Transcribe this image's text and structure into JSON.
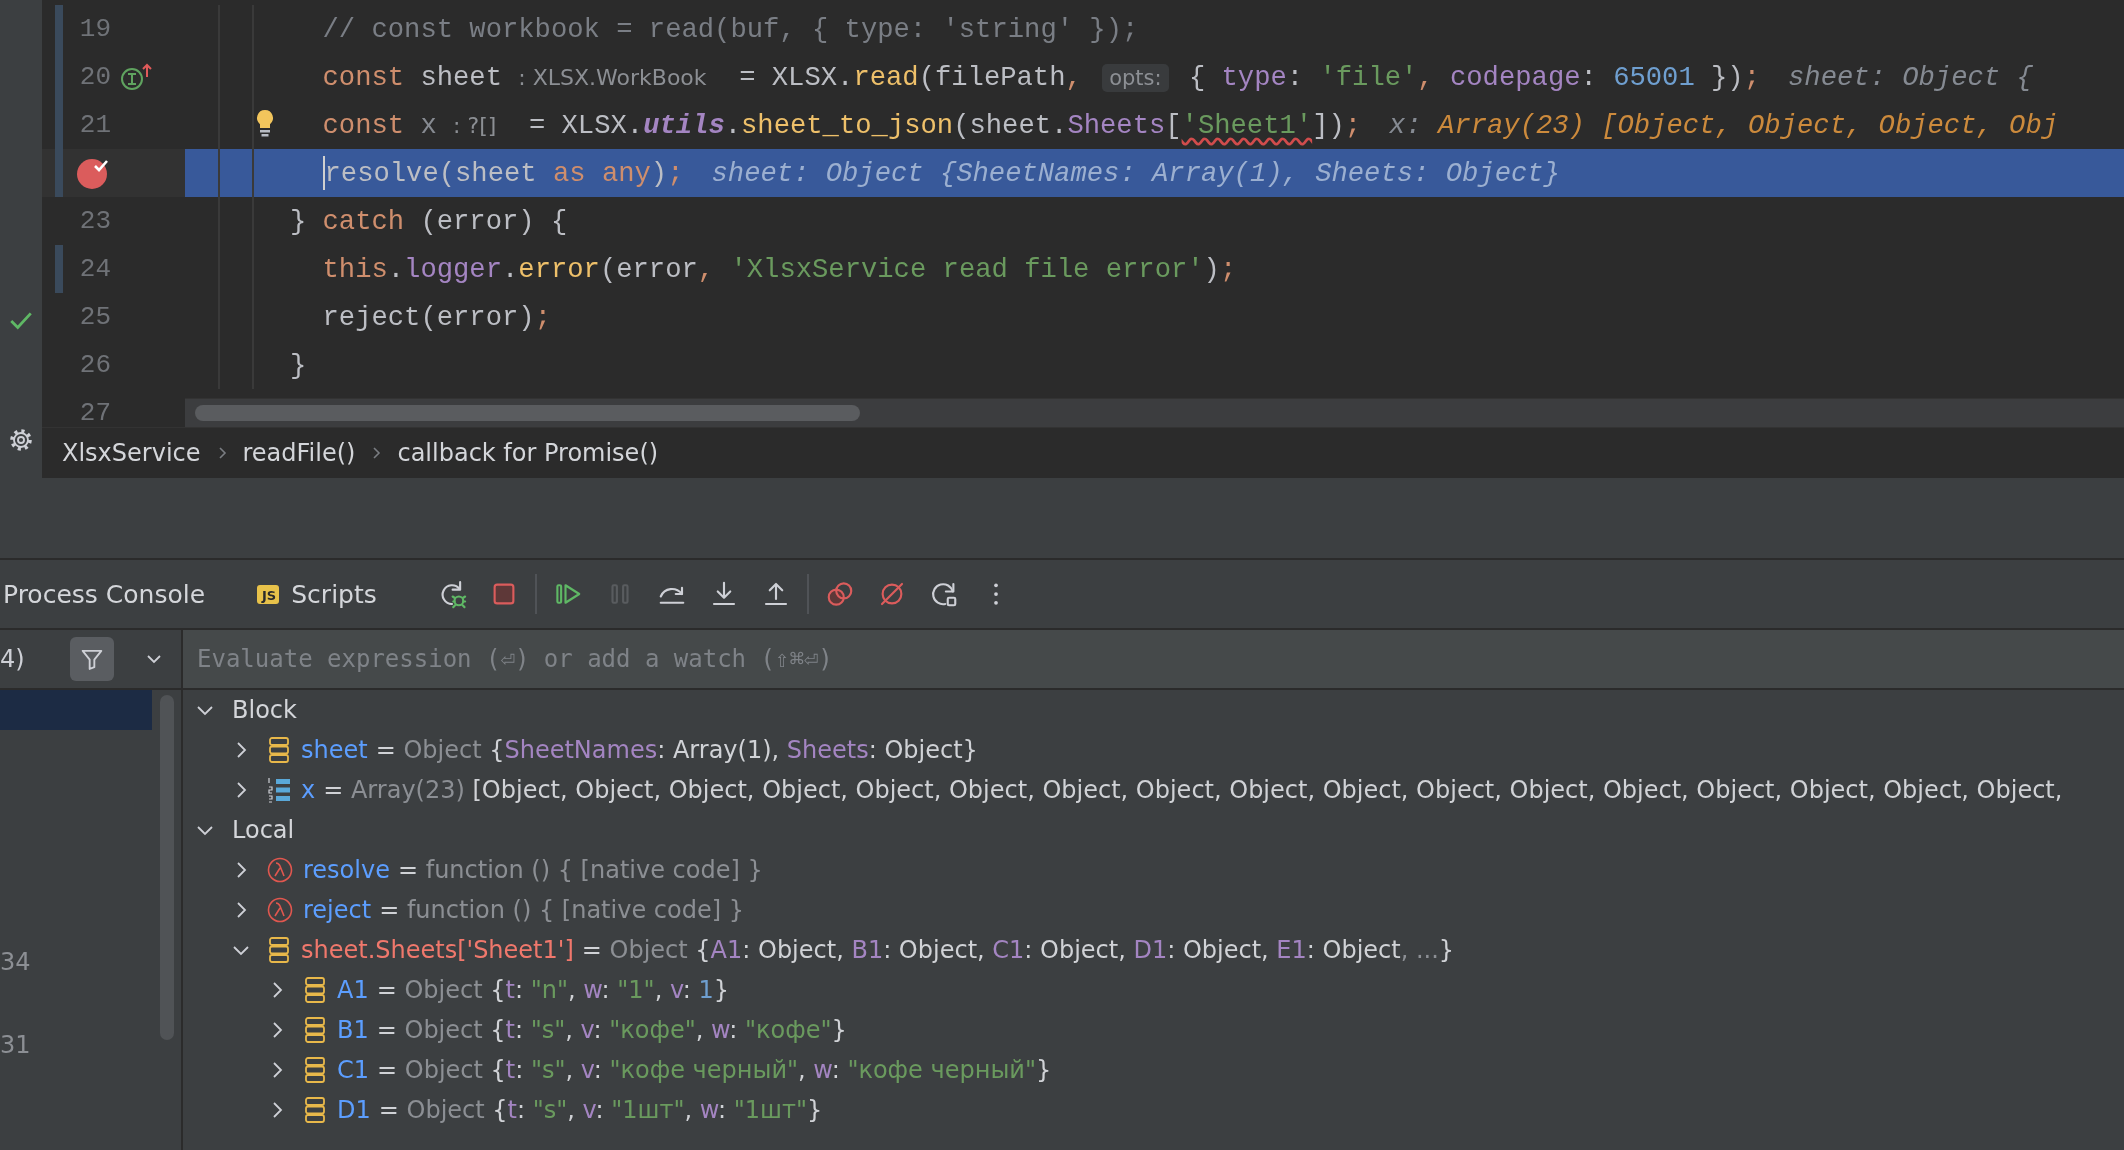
{
  "left_strip": {
    "icons": [
      {
        "kind": "check"
      },
      {
        "kind": "settings"
      }
    ]
  },
  "editor": {
    "lines": [
      {
        "number": "19",
        "changed": true,
        "current": false,
        "breakpoint": false,
        "bulb": false,
        "gutter_marker": false,
        "outer": false,
        "tokens": [
          {
            "kind": "comment",
            "text": "// const workbook = read(buf, { type: 'string' });"
          }
        ]
      },
      {
        "number": "20",
        "changed": true,
        "current": false,
        "breakpoint": false,
        "bulb": false,
        "gutter_marker": true,
        "outer": false,
        "tokens": [
          {
            "kind": "kw",
            "text": "const"
          },
          {
            "kind": "plain",
            "text": " sheet "
          },
          {
            "kind": "hint",
            "text": ": XLSX.WorkBook"
          },
          {
            "kind": "plain",
            "text": "  = XLSX."
          },
          {
            "kind": "method",
            "text": "read"
          },
          {
            "kind": "plain",
            "text": "(filePath"
          },
          {
            "kind": "kw",
            "text": ", "
          },
          {
            "kind": "hintbox",
            "text": "opts:"
          },
          {
            "kind": "plain",
            "text": " { "
          },
          {
            "kind": "prop",
            "text": "type"
          },
          {
            "kind": "plain",
            "text": ": "
          },
          {
            "kind": "str",
            "text": "'file'"
          },
          {
            "kind": "kw",
            "text": ", "
          },
          {
            "kind": "prop",
            "text": "codepage"
          },
          {
            "kind": "plain",
            "text": ": "
          },
          {
            "kind": "num",
            "text": "65001"
          },
          {
            "kind": "plain",
            "text": " })"
          },
          {
            "kind": "kw",
            "text": ";"
          }
        ],
        "inline_value": [
          {
            "kind": "dbg",
            "text": "sheet: Object {"
          }
        ]
      },
      {
        "number": "21",
        "changed": true,
        "current": false,
        "breakpoint": false,
        "bulb": true,
        "gutter_marker": false,
        "outer": false,
        "tokens": [
          {
            "kind": "kw",
            "text": "const"
          },
          {
            "kind": "unused",
            "text": " x "
          },
          {
            "kind": "hint",
            "text": ": ?[]"
          },
          {
            "kind": "plain",
            "text": "  = XLSX."
          },
          {
            "kind": "propital",
            "text": "utils"
          },
          {
            "kind": "plain",
            "text": "."
          },
          {
            "kind": "method",
            "text": "sheet_to_json"
          },
          {
            "kind": "plain",
            "text": "(sheet."
          },
          {
            "kind": "prop",
            "text": "Sheets"
          },
          {
            "kind": "plain",
            "text": "["
          },
          {
            "kind": "strwarn",
            "text": "'Sheet1'"
          },
          {
            "kind": "plain",
            "text": "])"
          },
          {
            "kind": "kw",
            "text": ";"
          }
        ],
        "inline_value": [
          {
            "kind": "dbg",
            "text": "x: "
          },
          {
            "kind": "dbgval",
            "text": "Array(23) [Object, Object, Object, Obj"
          }
        ]
      },
      {
        "changed": true,
        "current": true,
        "breakpoint": true,
        "bulb": false,
        "gutter_marker": false,
        "outer": false,
        "tokens": [
          {
            "kind": "plain",
            "text": "resolve(sheet "
          },
          {
            "kind": "kw",
            "text": "as any"
          },
          {
            "kind": "plain",
            "text": ")"
          },
          {
            "kind": "kw",
            "text": ";"
          }
        ],
        "inline_value": [
          {
            "kind": "dbg",
            "text": "sheet: Object {SheetNames: Array(1), Sheets: Object}"
          }
        ]
      },
      {
        "number": "23",
        "changed": false,
        "current": false,
        "breakpoint": false,
        "bulb": false,
        "gutter_marker": false,
        "outer": true,
        "tokens": [
          {
            "kind": "plain",
            "text": "} "
          },
          {
            "kind": "kw",
            "text": "catch"
          },
          {
            "kind": "plain",
            "text": " (error) {"
          }
        ]
      },
      {
        "number": "24",
        "changed": true,
        "current": false,
        "breakpoint": false,
        "bulb": false,
        "gutter_marker": false,
        "outer": false,
        "tokens": [
          {
            "kind": "kw",
            "text": "this"
          },
          {
            "kind": "plain",
            "text": "."
          },
          {
            "kind": "prop",
            "text": "logger"
          },
          {
            "kind": "plain",
            "text": "."
          },
          {
            "kind": "method",
            "text": "error"
          },
          {
            "kind": "plain",
            "text": "(error"
          },
          {
            "kind": "kw",
            "text": ", "
          },
          {
            "kind": "str",
            "text": "'XlsxService read file error'"
          },
          {
            "kind": "plain",
            "text": ")"
          },
          {
            "kind": "kw",
            "text": ";"
          }
        ]
      },
      {
        "number": "25",
        "changed": false,
        "current": false,
        "breakpoint": false,
        "bulb": false,
        "gutter_marker": false,
        "outer": false,
        "tokens": [
          {
            "kind": "plain",
            "text": "reject(error)"
          },
          {
            "kind": "kw",
            "text": ";"
          }
        ]
      },
      {
        "number": "26",
        "changed": false,
        "current": false,
        "breakpoint": false,
        "bulb": false,
        "gutter_marker": false,
        "outer": true,
        "tokens": [
          {
            "kind": "plain",
            "text": "}"
          }
        ]
      },
      {
        "number": "27",
        "changed": false,
        "current": false,
        "breakpoint": false,
        "bulb": false,
        "gutter_marker": false
      }
    ]
  },
  "breadcrumbs": [
    "XlsxService",
    "readFile()",
    "callback for Promise()"
  ],
  "debugger": {
    "tabs": [
      {
        "label": "Process Console"
      },
      {
        "label": "Scripts",
        "badge": "JS"
      }
    ],
    "toolbar": [
      {
        "kind": "rerun",
        "disabled": false
      },
      {
        "kind": "stop",
        "disabled": false
      },
      {
        "kind": "separator"
      },
      {
        "kind": "resume",
        "disabled": false
      },
      {
        "kind": "pause",
        "disabled": true
      },
      {
        "kind": "step-over",
        "disabled": false
      },
      {
        "kind": "step-into",
        "disabled": false
      },
      {
        "kind": "step-out",
        "disabled": false
      },
      {
        "kind": "separator"
      },
      {
        "kind": "breakpoints",
        "disabled": false
      },
      {
        "kind": "mute",
        "disabled": false
      },
      {
        "kind": "restart",
        "disabled": false
      },
      {
        "kind": "more",
        "disabled": false
      }
    ],
    "frames": {
      "count_text": "4)",
      "filter_on": true,
      "selected_row": {
        "selected": true
      },
      "rows": [
        {
          "text": "34",
          "selected": false
        },
        {
          "text": "31",
          "selected": false
        }
      ]
    },
    "watch_field": {
      "placeholder": "Evaluate expression (⏎) or add a watch (⇧⌘⏎)"
    },
    "variables": [
      {
        "name": "Block",
        "kind": "group",
        "expanded": true,
        "children": [
          {
            "name": "sheet",
            "kind": "object",
            "expanded": false,
            "color": "#5c9eff",
            "value": [
              {
                "kind": "plain",
                "text": "= "
              },
              {
                "kind": "type",
                "text": "Object "
              },
              {
                "kind": "plain",
                "text": "{"
              },
              {
                "kind": "key",
                "text": "SheetNames"
              },
              {
                "kind": "plain",
                "text": ": Array(1), "
              },
              {
                "kind": "key",
                "text": "Sheets"
              },
              {
                "kind": "plain",
                "text": ": Object}"
              }
            ]
          },
          {
            "name": "x",
            "kind": "array",
            "expanded": false,
            "color": "#5c9eff",
            "value": [
              {
                "kind": "plain",
                "text": "= "
              },
              {
                "kind": "type",
                "text": "Array(23) "
              },
              {
                "kind": "plain",
                "text": "[Object, Object, Object, Object, Object, Object, Object, Object, Object, Object, Object, Object, Object, Object, Object, Object, Object,"
              }
            ]
          }
        ]
      },
      {
        "name": "Local",
        "kind": "group",
        "expanded": true,
        "children": [
          {
            "name": "resolve",
            "kind": "function",
            "expanded": false,
            "color": "#5c9eff",
            "value": [
              {
                "kind": "plain",
                "text": "= "
              },
              {
                "kind": "type",
                "text": "function () { [native code] }"
              }
            ]
          },
          {
            "name": "reject",
            "kind": "function",
            "expanded": false,
            "color": "#5c9eff",
            "value": [
              {
                "kind": "plain",
                "text": "= "
              },
              {
                "kind": "type",
                "text": "function () { [native code] }"
              }
            ]
          },
          {
            "name": "sheet.Sheets['Sheet1']",
            "kind": "object",
            "expanded": true,
            "color": "#f0786c",
            "value": [
              {
                "kind": "plain",
                "text": "= "
              },
              {
                "kind": "type",
                "text": "Object "
              },
              {
                "kind": "plain",
                "text": "{"
              },
              {
                "kind": "key",
                "text": "A1"
              },
              {
                "kind": "plain",
                "text": ": Object, "
              },
              {
                "kind": "key",
                "text": "B1"
              },
              {
                "kind": "plain",
                "text": ": Object, "
              },
              {
                "kind": "key",
                "text": "C1"
              },
              {
                "kind": "plain",
                "text": ": Object, "
              },
              {
                "kind": "key",
                "text": "D1"
              },
              {
                "kind": "plain",
                "text": ": Object, "
              },
              {
                "kind": "key",
                "text": "E1"
              },
              {
                "kind": "plain",
                "text": ": Object"
              },
              {
                "kind": "type",
                "text": ", ..."
              },
              {
                "kind": "plain",
                "text": "}"
              }
            ],
            "children": [
              {
                "name": "A1",
                "kind": "object",
                "expanded": false,
                "color": "#5c9eff",
                "value": [
                  {
                    "kind": "plain",
                    "text": "= "
                  },
                  {
                    "kind": "type",
                    "text": "Object "
                  },
                  {
                    "kind": "plain",
                    "text": "{"
                  },
                  {
                    "kind": "key",
                    "text": "t"
                  },
                  {
                    "kind": "plain",
                    "text": ": "
                  },
                  {
                    "kind": "str",
                    "text": "\"n\""
                  },
                  {
                    "kind": "plain",
                    "text": ", "
                  },
                  {
                    "kind": "key",
                    "text": "w"
                  },
                  {
                    "kind": "plain",
                    "text": ": "
                  },
                  {
                    "kind": "str",
                    "text": "\"1\""
                  },
                  {
                    "kind": "plain",
                    "text": ", "
                  },
                  {
                    "kind": "key",
                    "text": "v"
                  },
                  {
                    "kind": "plain",
                    "text": ": "
                  },
                  {
                    "kind": "num",
                    "text": "1"
                  },
                  {
                    "kind": "plain",
                    "text": "}"
                  }
                ]
              },
              {
                "name": "B1",
                "kind": "object",
                "expanded": false,
                "color": "#5c9eff",
                "value": [
                  {
                    "kind": "plain",
                    "text": "= "
                  },
                  {
                    "kind": "type",
                    "text": "Object "
                  },
                  {
                    "kind": "plain",
                    "text": "{"
                  },
                  {
                    "kind": "key",
                    "text": "t"
                  },
                  {
                    "kind": "plain",
                    "text": ": "
                  },
                  {
                    "kind": "str",
                    "text": "\"s\""
                  },
                  {
                    "kind": "plain",
                    "text": ", "
                  },
                  {
                    "kind": "key",
                    "text": "v"
                  },
                  {
                    "kind": "plain",
                    "text": ": "
                  },
                  {
                    "kind": "str",
                    "text": "\"кофе\""
                  },
                  {
                    "kind": "plain",
                    "text": ", "
                  },
                  {
                    "kind": "key",
                    "text": "w"
                  },
                  {
                    "kind": "plain",
                    "text": ": "
                  },
                  {
                    "kind": "str",
                    "text": "\"кофе\""
                  },
                  {
                    "kind": "plain",
                    "text": "}"
                  }
                ]
              },
              {
                "name": "C1",
                "kind": "object",
                "expanded": false,
                "color": "#5c9eff",
                "value": [
                  {
                    "kind": "plain",
                    "text": "= "
                  },
                  {
                    "kind": "type",
                    "text": "Object "
                  },
                  {
                    "kind": "plain",
                    "text": "{"
                  },
                  {
                    "kind": "key",
                    "text": "t"
                  },
                  {
                    "kind": "plain",
                    "text": ": "
                  },
                  {
                    "kind": "str",
                    "text": "\"s\""
                  },
                  {
                    "kind": "plain",
                    "text": ", "
                  },
                  {
                    "kind": "key",
                    "text": "v"
                  },
                  {
                    "kind": "plain",
                    "text": ": "
                  },
                  {
                    "kind": "str",
                    "text": "\"кофе черный\""
                  },
                  {
                    "kind": "plain",
                    "text": ", "
                  },
                  {
                    "kind": "key",
                    "text": "w"
                  },
                  {
                    "kind": "plain",
                    "text": ": "
                  },
                  {
                    "kind": "str",
                    "text": "\"кофе черный\""
                  },
                  {
                    "kind": "plain",
                    "text": "}"
                  }
                ]
              },
              {
                "name": "D1",
                "kind": "object",
                "expanded": false,
                "color": "#5c9eff",
                "value": [
                  {
                    "kind": "plain",
                    "text": "= "
                  },
                  {
                    "kind": "type",
                    "text": "Object "
                  },
                  {
                    "kind": "plain",
                    "text": "{"
                  },
                  {
                    "kind": "key",
                    "text": "t"
                  },
                  {
                    "kind": "plain",
                    "text": ": "
                  },
                  {
                    "kind": "str",
                    "text": "\"s\""
                  },
                  {
                    "kind": "plain",
                    "text": ", "
                  },
                  {
                    "kind": "key",
                    "text": "v"
                  },
                  {
                    "kind": "plain",
                    "text": ": "
                  },
                  {
                    "kind": "str",
                    "text": "\"1шт\""
                  },
                  {
                    "kind": "plain",
                    "text": ", "
                  },
                  {
                    "kind": "key",
                    "text": "w"
                  },
                  {
                    "kind": "plain",
                    "text": ": "
                  },
                  {
                    "kind": "str",
                    "text": "\"1шт\""
                  },
                  {
                    "kind": "plain",
                    "text": "}"
                  }
                ]
              }
            ]
          }
        ]
      }
    ]
  }
}
